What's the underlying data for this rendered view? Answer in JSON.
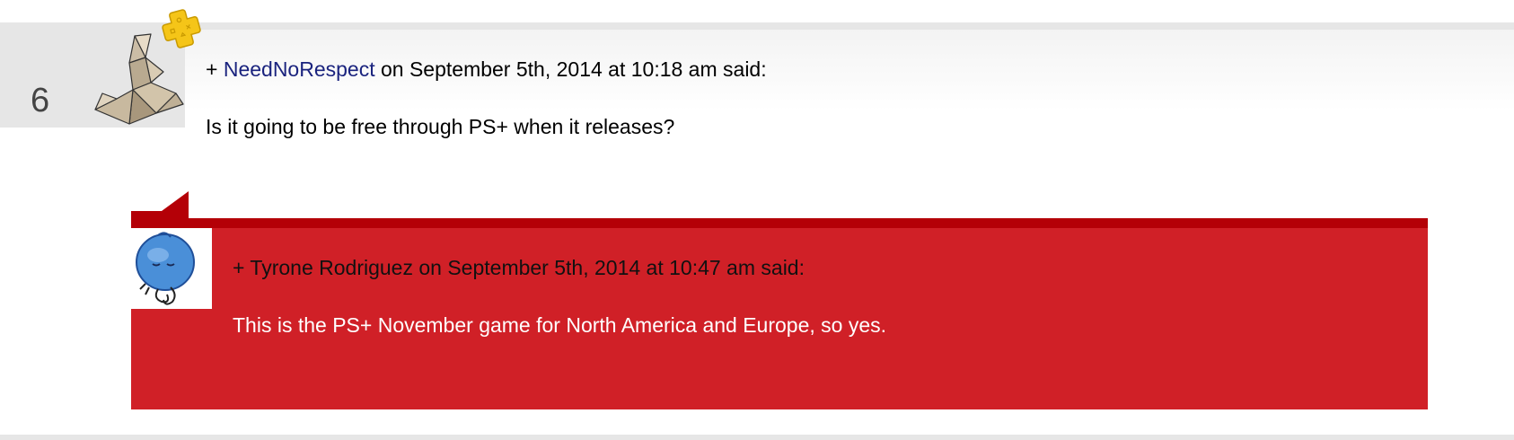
{
  "comment": {
    "number": "6",
    "plus": "+",
    "author": "NeedNoRespect",
    "meta": "on September 5th, 2014 at 10:18 am said:",
    "body": "Is it going to be free through PS+ when it releases?",
    "avatar_icon": "origami-crane-icon",
    "badge_icon": "ps-plus-icon"
  },
  "reply": {
    "plus": "+",
    "author": "Tyrone Rodriguez",
    "meta": "on September 5th, 2014 at 10:47 am said:",
    "body": "This is the PS+ November game for North America and Europe, so yes.",
    "avatar_icon": "blue-blob-character-icon"
  },
  "colors": {
    "author_link": "#1a237e",
    "reply_background": "#d02027",
    "reply_strip": "#b40007",
    "number_box": "#e6e6e6",
    "ps_plus_gold": "#f5c518"
  }
}
